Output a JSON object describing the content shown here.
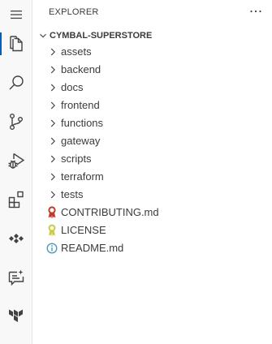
{
  "explorer": {
    "title": "EXPLORER",
    "more_actions": "···",
    "section_title": "CYMBAL-SUPERSTORE"
  },
  "activity_bar": {
    "items": [
      {
        "name": "menu-icon"
      },
      {
        "name": "explorer-icon",
        "active": true
      },
      {
        "name": "search-icon"
      },
      {
        "name": "source-control-icon"
      },
      {
        "name": "run-debug-icon"
      },
      {
        "name": "extensions-icon"
      },
      {
        "name": "dots-diamond-icon"
      },
      {
        "name": "comment-sparkle-icon"
      },
      {
        "name": "terraform-icon"
      }
    ]
  },
  "tree": {
    "folders": [
      "assets",
      "backend",
      "docs",
      "frontend",
      "functions",
      "gateway",
      "scripts",
      "terraform",
      "tests"
    ],
    "files": [
      {
        "label": "CONTRIBUTING.md",
        "icon": "ribbon-icon",
        "color": "#c0392b"
      },
      {
        "label": "LICENSE",
        "icon": "license-key-icon",
        "color": "#cbcb41"
      },
      {
        "label": "README.md",
        "icon": "info-icon",
        "color": "#519aba"
      }
    ]
  },
  "colors": {
    "accent": "#005fb8",
    "icon": "#424242",
    "text": "#3b3b3b"
  }
}
